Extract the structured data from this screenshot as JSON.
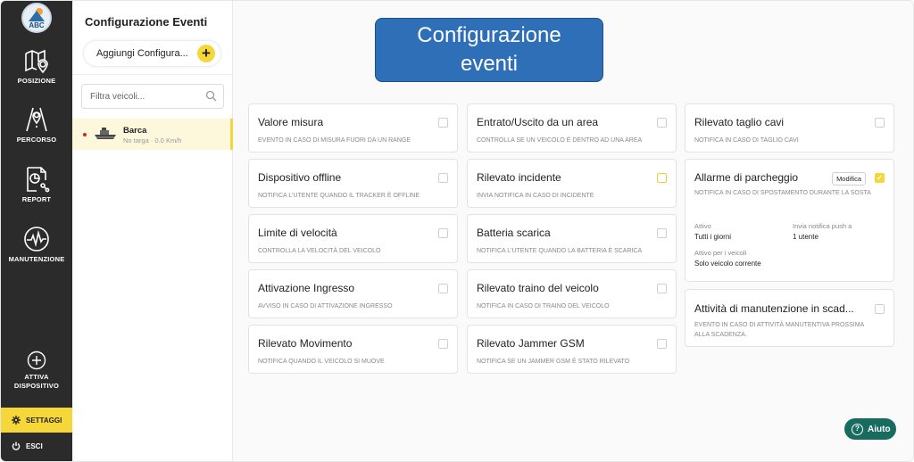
{
  "nav": {
    "logo_text": "ABC",
    "items": [
      {
        "label": "POSIZIONE",
        "icon": "map-pin-icon"
      },
      {
        "label": "PERCORSO",
        "icon": "route-icon"
      },
      {
        "label": "REPORT",
        "icon": "report-icon"
      },
      {
        "label": "MANUTENZIONE",
        "icon": "heartbeat-icon"
      }
    ],
    "activate_line1": "ATTIVA",
    "activate_line2": "DISPOSITIVO",
    "settings": "SETTAGGI",
    "logout": "ESCI"
  },
  "panel": {
    "title": "Configurazione Eventi",
    "add_label": "Aggiungi Configura...",
    "add_plus": "+",
    "filter_placeholder": "Filtra veicoli...",
    "vehicle": {
      "name": "Barca",
      "sub": "No targa · 0.0 Km/h"
    }
  },
  "banner": {
    "line1": "Configurazione",
    "line2": "eventi"
  },
  "events": {
    "col1": [
      {
        "title": "Valore misura",
        "desc": "EVENTO IN CASO DI MISURA FUORI DA UN RANGE"
      },
      {
        "title": "Dispositivo offline",
        "desc": "NOTIFICA L'UTENTE QUANDO IL TRACKER È OFFLINE"
      },
      {
        "title": "Limite di velocità",
        "desc": "CONTROLLA LA VELOCITÀ DEL VEICOLO"
      },
      {
        "title": "Attivazione Ingresso",
        "desc": "AVVISO IN CASO DI ATTIVAZIONE INGRESSO"
      },
      {
        "title": "Rilevato Movimento",
        "desc": "NOTIFICA QUANDO IL VEICOLO SI MUOVE"
      }
    ],
    "col2": [
      {
        "title": "Entrato/Uscito da un area",
        "desc": "CONTROLLA SE UN VEICOLO È DENTRO AD UNA AREA"
      },
      {
        "title": "Rilevato incidente",
        "desc": "INVIA NOTIFICA IN CASO DI INCIDENTE"
      },
      {
        "title": "Batteria scarica",
        "desc": "NOTIFICA L'UTENTE QUANDO LA BATTERIA È SCARICA"
      },
      {
        "title": "Rilevato traino del veicolo",
        "desc": "NOTIFICA IN CASO DI TRAINO DEL VEICOLO"
      },
      {
        "title": "Rilevato Jammer GSM",
        "desc": "NOTIFICA SE UN JAMMER GSM È STATO RILEVATO"
      }
    ],
    "col3": {
      "taglio": {
        "title": "Rilevato taglio cavi",
        "desc": "NOTIFICA IN CASO DI TAGLIO CAVI"
      },
      "parcheggio": {
        "title": "Allarme di parcheggio",
        "desc": "NOTIFICA IN CASO DI SPOSTAMENTO DURANTE LA SOSTA",
        "edit": "Modifica",
        "check": "✓",
        "active_label": "Attivo",
        "active_value": "Tutti i giorni",
        "push_label": "Invia notifica push a",
        "push_value": "1 utente",
        "vehicles_label": "Attivo per i veicoli",
        "vehicles_value": "Solo veicolo corrente"
      },
      "manutenzione": {
        "title": "Attività di manutenzione in scad...",
        "desc": "EVENTO IN CASO DI ATTIVITÀ MANUTENTIVA PROSSIMA ALLA SCADENZA."
      }
    }
  },
  "help": {
    "icon": "?",
    "label": "Aiuto"
  },
  "colors": {
    "accent": "#f5d73a",
    "nav_bg": "#2b2b2b",
    "banner": "#2e6fb7",
    "help": "#176c5f"
  }
}
